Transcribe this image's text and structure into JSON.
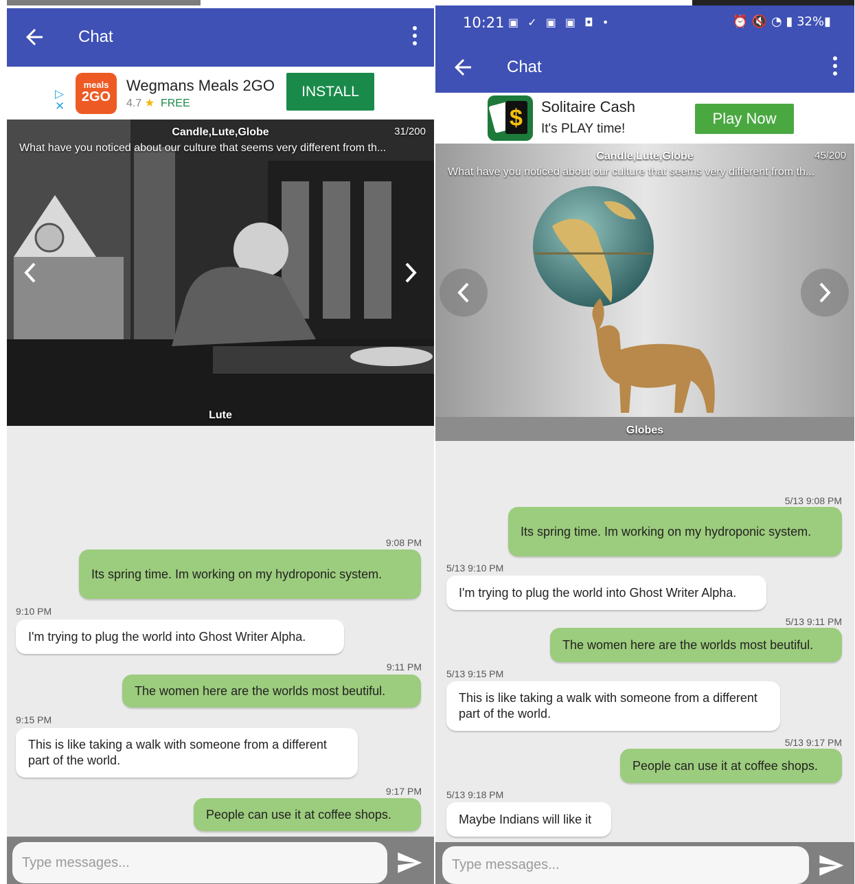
{
  "left": {
    "appbar": {
      "title": "Chat"
    },
    "ad": {
      "app_name": "Wegmans Meals 2GO",
      "icon_text_top": "meals",
      "icon_text_bottom": "2GO",
      "rating": "4.7",
      "star": "★",
      "price": "FREE",
      "button": "INSTALL"
    },
    "banner": {
      "categories": "Candle,Lute,Globe",
      "counter": "31/200",
      "question": "What have you noticed about our culture that seems very different from  th...",
      "caption": "Lute"
    },
    "messages": [
      {
        "time": "9:08 PM",
        "text": "Its spring time.  Im working on my hydroponic system.",
        "dir": "out"
      },
      {
        "time": "9:10 PM",
        "text": "I'm trying to plug the world into Ghost Writer Alpha.",
        "dir": "in"
      },
      {
        "time": "9:11 PM",
        "text": "The women here are the worlds most beutiful.",
        "dir": "out"
      },
      {
        "time": "9:15 PM",
        "text": "This is like taking a walk with someone from a different part of the world.",
        "dir": "in"
      },
      {
        "time": "9:17 PM",
        "text": "People can use it at coffee shops.",
        "dir": "out"
      }
    ],
    "input_placeholder": "Type messages..."
  },
  "right": {
    "statusbar": {
      "time": "10:21",
      "notification_icons": "▣ ✓ ▣ ▣ ◘ •",
      "system_icons": "⏰ 🔇 ◔ ▮ 32%▮"
    },
    "appbar": {
      "title": "Chat"
    },
    "ad": {
      "app_name": "Solitaire Cash",
      "tagline": "It's PLAY time!",
      "icon_symbol": "$",
      "button": "Play Now"
    },
    "banner": {
      "categories": "Candle,Lute,Globe",
      "counter": "45/200",
      "question": "What have you noticed about our culture that seems very different from  th...",
      "caption": "Globes"
    },
    "messages": [
      {
        "time": "5/13 9:08 PM",
        "text": "Its spring time.  Im working on my hydroponic system.",
        "dir": "out"
      },
      {
        "time": "5/13 9:10 PM",
        "text": "I'm trying to plug the world into Ghost Writer Alpha.",
        "dir": "in"
      },
      {
        "time": "5/13 9:11 PM",
        "text": "The women here are the worlds most beutiful.",
        "dir": "out"
      },
      {
        "time": "5/13 9:15 PM",
        "text": "This is like taking a walk with someone from a different part of the world.",
        "dir": "in"
      },
      {
        "time": "5/13 9:17 PM",
        "text": "People can use it at coffee shops.",
        "dir": "out"
      },
      {
        "time": "5/13 9:18 PM",
        "text": "Maybe Indians will like it",
        "dir": "in"
      }
    ],
    "input_placeholder": "Type messages..."
  },
  "colors": {
    "appbar": "#3f51b5",
    "outgoing_bubble": "#9ccc7d",
    "incoming_bubble": "#ffffff",
    "chat_background": "#ebebeb",
    "install_button": "#1a8a4a",
    "play_now_button": "#4aa840"
  }
}
